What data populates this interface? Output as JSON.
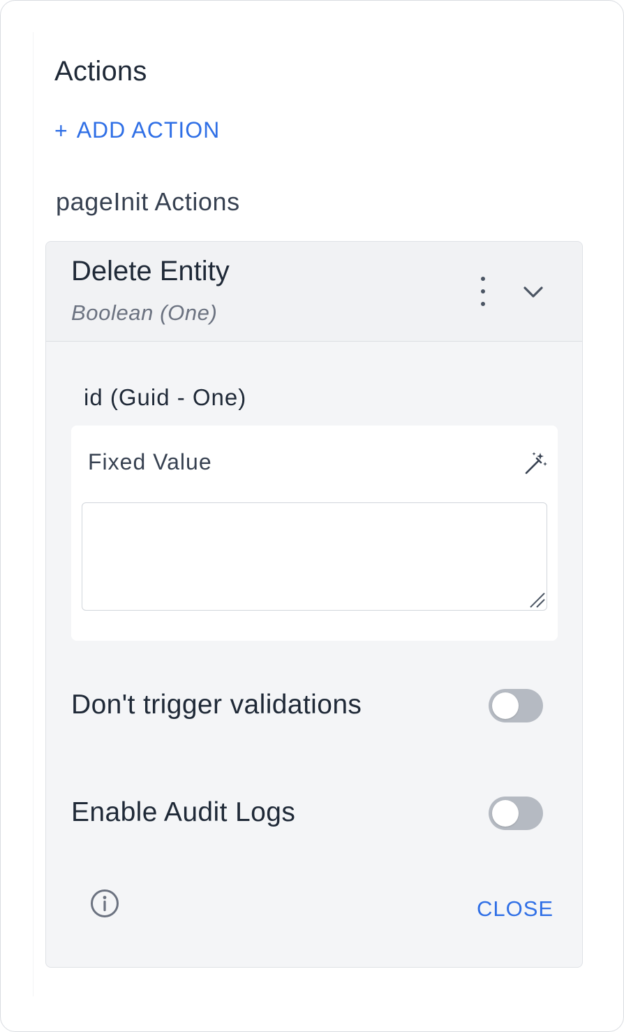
{
  "panel": {
    "title": "Actions",
    "add_action": {
      "plus": "+",
      "label": "ADD ACTION"
    },
    "group_title": "pageInit Actions"
  },
  "action_card": {
    "name": "Delete Entity",
    "type": "Boolean (One)",
    "icons": {
      "menu": "more-vertical-icon",
      "expand": "chevron-down-icon"
    },
    "parameter": {
      "label": "id (Guid - One)",
      "value_mode": "Fixed Value",
      "value": "",
      "mode_icon": "magic-wand-icon"
    },
    "toggles": [
      {
        "label": "Don't trigger validations",
        "on": false
      },
      {
        "label": "Enable Audit Logs",
        "on": false
      }
    ],
    "footer": {
      "info_icon": "info-icon",
      "close_label": "CLOSE"
    }
  },
  "colors": {
    "accent": "#2f6fe6",
    "card_bg": "#f4f5f7",
    "toggle_off": "#b5bac2"
  }
}
